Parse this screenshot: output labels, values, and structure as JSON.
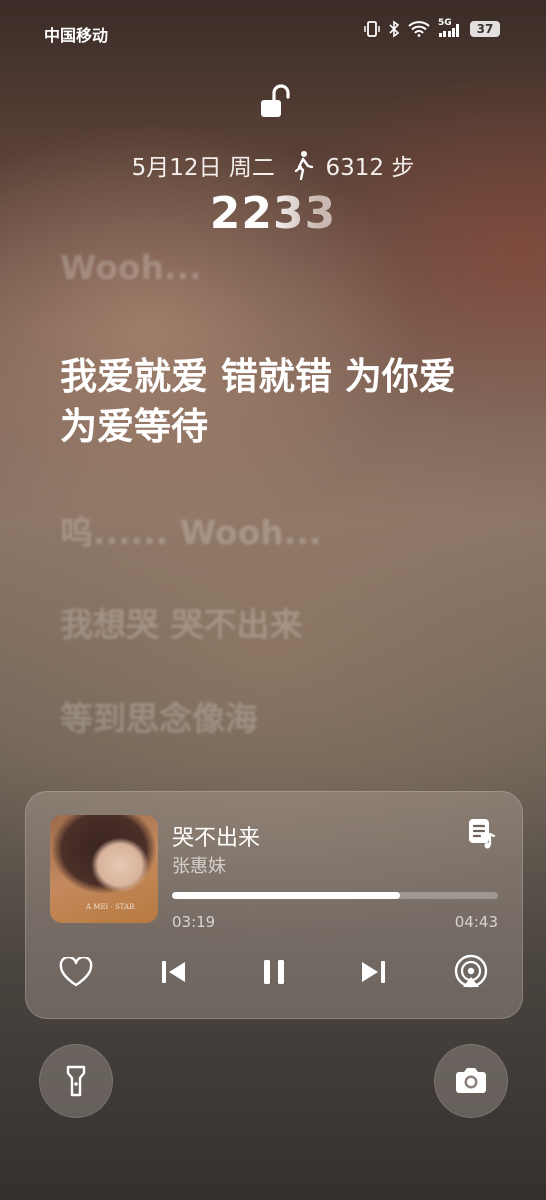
{
  "status_bar": {
    "carrier": "中国移动",
    "network": "5G",
    "battery": "37",
    "icons": [
      "vibrate-icon",
      "bluetooth-icon",
      "wifi-icon",
      "signal-5g-icon",
      "battery-icon"
    ]
  },
  "lock_screen": {
    "lock_icon": "unlocked-padlock-icon",
    "date": "5月12日 周二",
    "steps_icon": "walking-person-icon",
    "steps": "6312 步",
    "time": "2233"
  },
  "lyrics": {
    "previous": "Wooh...",
    "current": "我爱就爱 错就错 为你爱 为爱等待",
    "next": [
      "呜...... Wooh...",
      "我想哭 哭不出来",
      "等到思念像海"
    ]
  },
  "player": {
    "album_cover_text": "A MEI · STAR",
    "song_title": "哭不出来",
    "artist": "张惠妹",
    "elapsed": "03:19",
    "duration": "04:43",
    "progress": 0.7,
    "lyrics_button_icon": "lyrics-icon",
    "controls": [
      "heart-icon",
      "previous-icon",
      "pause-icon",
      "next-icon",
      "cast-icon"
    ]
  },
  "shortcuts": {
    "left": "flashlight-icon",
    "right": "camera-icon"
  }
}
